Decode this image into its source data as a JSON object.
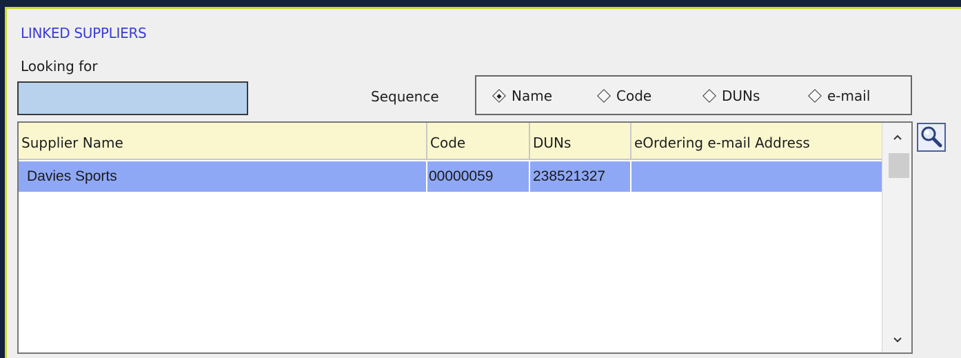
{
  "panel": {
    "title": "LINKED SUPPLIERS"
  },
  "search": {
    "label": "Looking for",
    "value": "",
    "placeholder": ""
  },
  "sequence": {
    "label": "Sequence",
    "selected": "Name",
    "options": [
      "Name",
      "Code",
      "DUNs",
      "e-mail"
    ]
  },
  "table": {
    "columns": [
      "Supplier Name",
      "Code",
      "DUNs",
      "eOrdering e-mail Address"
    ],
    "rows": [
      {
        "name": "Davies Sports",
        "code": "00000059",
        "duns": "238521327",
        "email": ""
      }
    ],
    "selected_row": 0
  },
  "icons": {
    "search_button": "magnifier-icon",
    "scroll_up": "chevron-up-icon",
    "scroll_down": "chevron-down-icon"
  },
  "colors": {
    "title": "#3b3bd6",
    "input_bg": "#b8d2ee",
    "header_bg": "#faf7cf",
    "selected_row": "#8fa8f6",
    "window_bg": "#15223f",
    "frame_accent": "#cfdc2a"
  }
}
